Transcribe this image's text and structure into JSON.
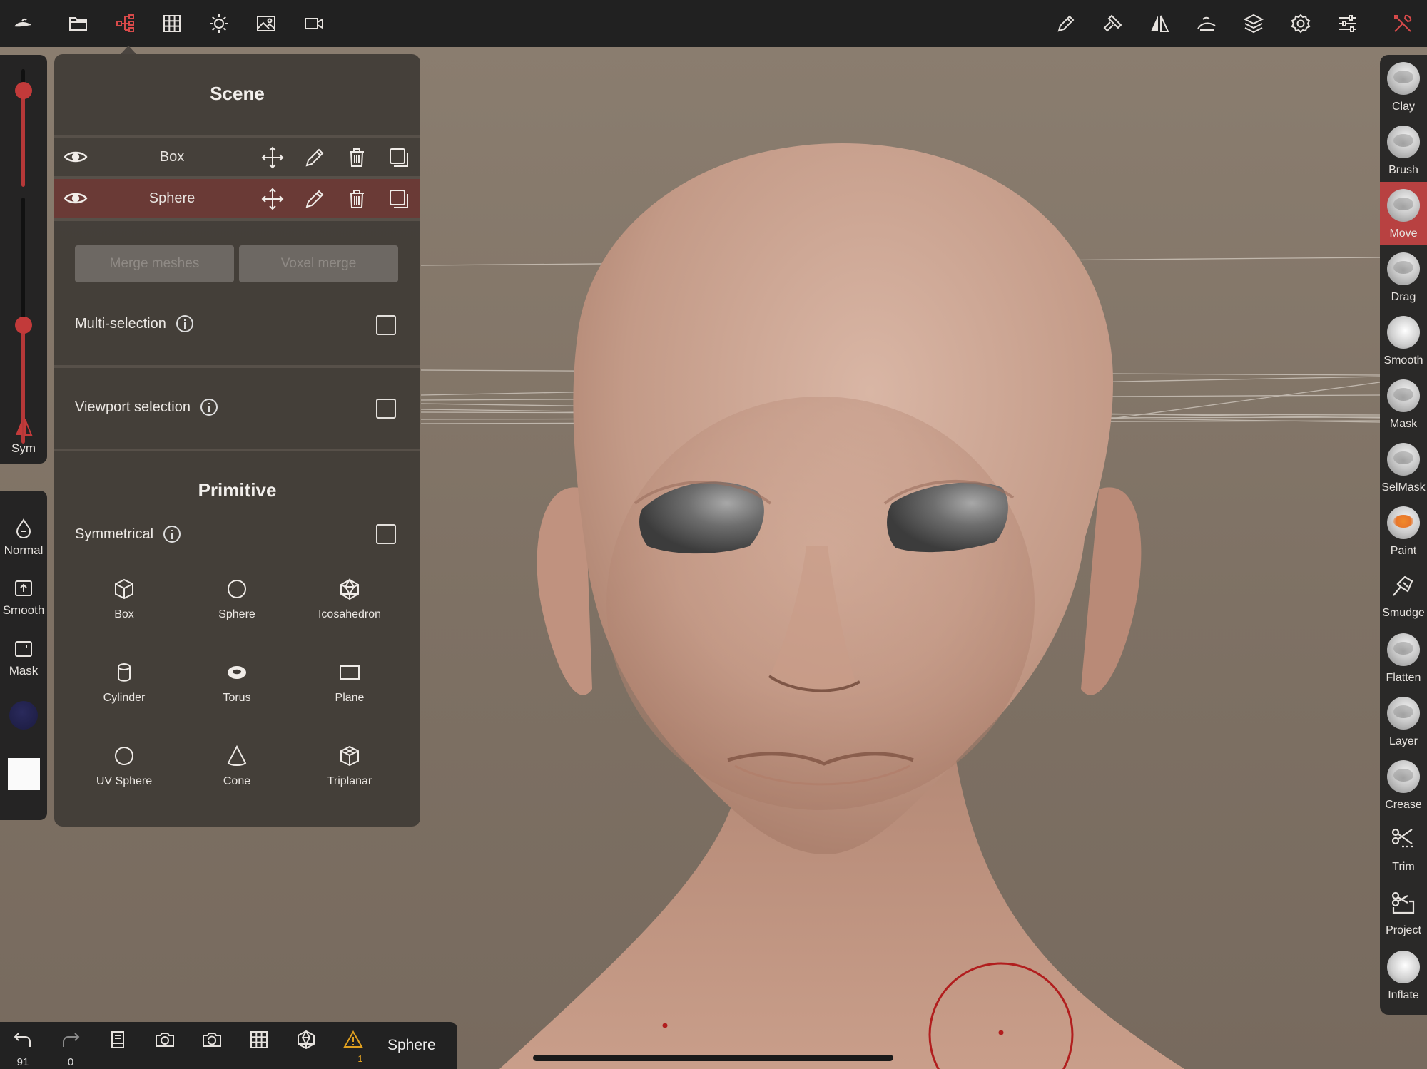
{
  "toolbar": {
    "left_icons": [
      "logo-icon",
      "folder-icon",
      "scene-tree-icon",
      "grid-icon",
      "sun-icon",
      "image-icon",
      "camera-icon"
    ],
    "right_icons": [
      "pen-icon",
      "hammer-icon",
      "symmetry-icon",
      "wand-icon",
      "layers-icon",
      "settings-icon",
      "sliders-icon",
      "tools-icon"
    ],
    "active_color": "#d84a4a"
  },
  "left_strip": {
    "sym_label": "Sym",
    "normal_label": "Normal",
    "smooth_label": "Smooth",
    "mask_label": "Mask",
    "radius_level": 0.82,
    "intensity_level": 0.48,
    "color_swatch": "#1b1b40",
    "material_swatch": "#fafafa"
  },
  "panel": {
    "scene_title": "Scene",
    "objects": [
      {
        "name": "Box",
        "selected": false
      },
      {
        "name": "Sphere",
        "selected": true
      }
    ],
    "merge_meshes": "Merge meshes",
    "voxel_merge": "Voxel merge",
    "multi_selection": "Multi-selection",
    "viewport_selection": "Viewport selection",
    "primitive_title": "Primitive",
    "symmetrical": "Symmetrical",
    "primitives": [
      "Box",
      "Sphere",
      "Icosahedron",
      "Cylinder",
      "Torus",
      "Plane",
      "UV Sphere",
      "Cone",
      "Triplanar"
    ],
    "selected_row_color": "#6a3a36"
  },
  "tools": [
    {
      "label": "Clay",
      "active": false
    },
    {
      "label": "Brush",
      "active": false
    },
    {
      "label": "Move",
      "active": true
    },
    {
      "label": "Drag",
      "active": false
    },
    {
      "label": "Smooth",
      "active": false
    },
    {
      "label": "Mask",
      "active": false
    },
    {
      "label": "SelMask",
      "active": false
    },
    {
      "label": "Paint",
      "active": false
    },
    {
      "label": "Smudge",
      "active": false
    },
    {
      "label": "Flatten",
      "active": false
    },
    {
      "label": "Layer",
      "active": false
    },
    {
      "label": "Crease",
      "active": false
    },
    {
      "label": "Trim",
      "active": false
    },
    {
      "label": "Project",
      "active": false
    },
    {
      "label": "Inflate",
      "active": false
    }
  ],
  "bottom": {
    "undo_count": "91",
    "redo_count": "0",
    "warning_count": "1",
    "selected_object": "Sphere",
    "warning_color": "#e0a020"
  }
}
